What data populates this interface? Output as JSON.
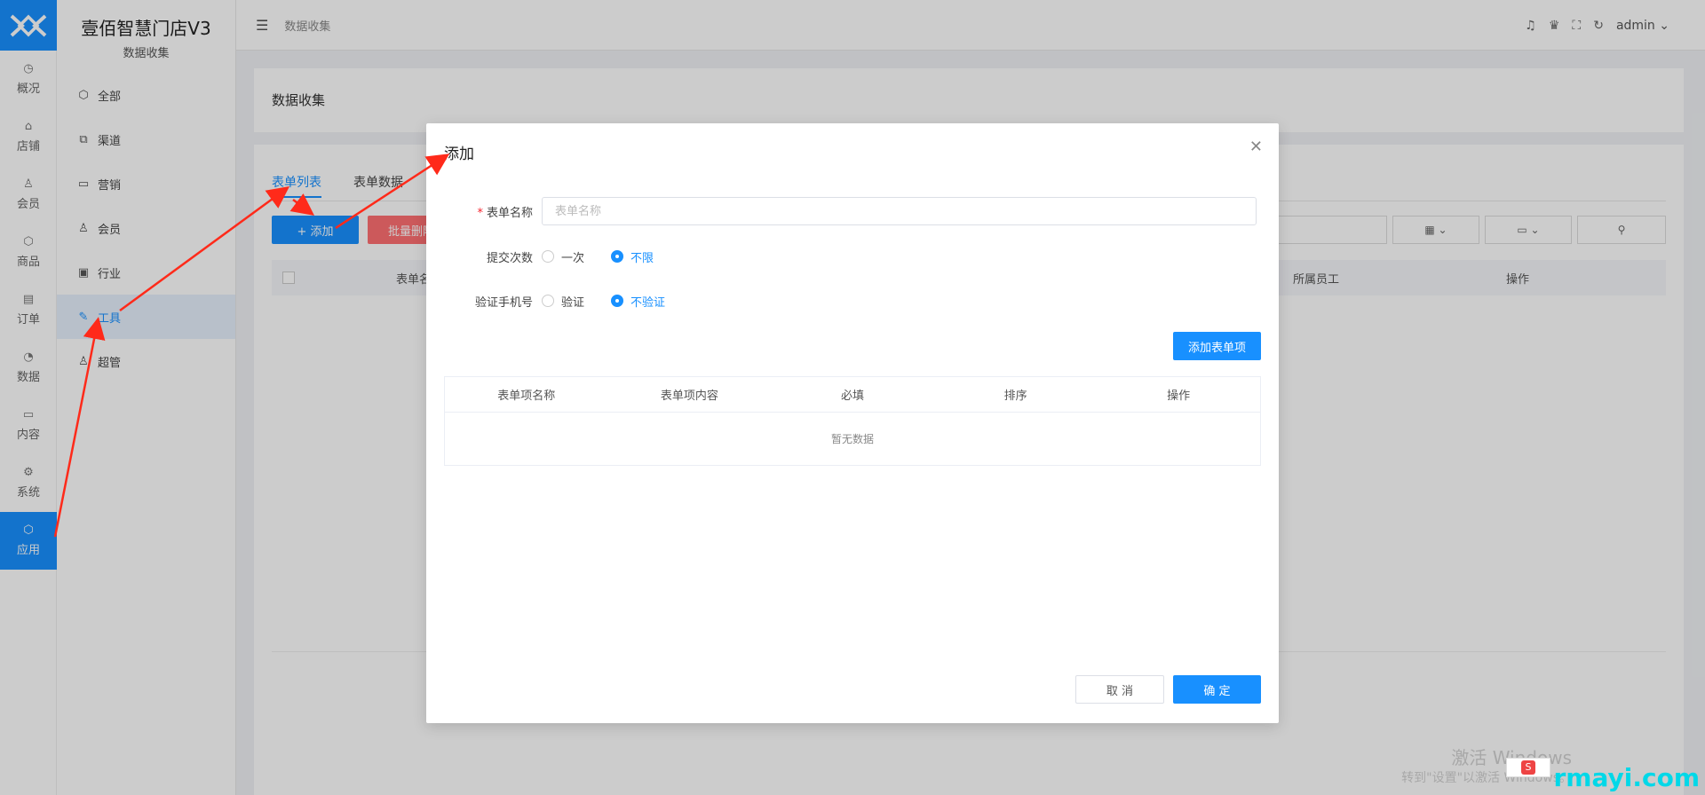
{
  "rail": {
    "items": [
      {
        "label": "概况",
        "icon": "dashboard-icon"
      },
      {
        "label": "店铺",
        "icon": "store-icon"
      },
      {
        "label": "会员",
        "icon": "user-icon"
      },
      {
        "label": "商品",
        "icon": "box-icon"
      },
      {
        "label": "订单",
        "icon": "clipboard-icon"
      },
      {
        "label": "数据",
        "icon": "pie-chart-icon"
      },
      {
        "label": "内容",
        "icon": "file-icon"
      },
      {
        "label": "系统",
        "icon": "gear-icon"
      },
      {
        "label": "应用",
        "icon": "app-icon"
      }
    ]
  },
  "sidebar": {
    "title": "壹佰智慧门店V3",
    "subtitle": "数据收集",
    "items": [
      {
        "label": "全部"
      },
      {
        "label": "渠道"
      },
      {
        "label": "营销"
      },
      {
        "label": "会员"
      },
      {
        "label": "行业"
      },
      {
        "label": "工具"
      },
      {
        "label": "超管"
      }
    ]
  },
  "header": {
    "breadcrumb": "数据收集",
    "user": "admin"
  },
  "page": {
    "title": "数据收集",
    "tabs": [
      "表单列表",
      "表单数据"
    ],
    "add_button": "+ 添加",
    "batch_button": "批量删除",
    "columns": [
      "表单名称",
      "所属员工",
      "操作"
    ]
  },
  "modal": {
    "title": "添加",
    "form_name_label": "表单名称",
    "form_name_placeholder": "表单名称",
    "submit_times_label": "提交次数",
    "submit_options": [
      "一次",
      "不限"
    ],
    "verify_phone_label": "验证手机号",
    "verify_options": [
      "验证",
      "不验证"
    ],
    "add_item_button": "添加表单项",
    "table_columns": [
      "表单项名称",
      "表单项内容",
      "必填",
      "排序",
      "操作"
    ],
    "empty_text": "暂无数据",
    "cancel": "取 消",
    "confirm": "确 定"
  },
  "watermark": {
    "line1": "激活 Windows",
    "line2": "转到\"设置\"以激活 Windows。",
    "site": "rmayi.com"
  },
  "colors": {
    "primary": "#1890ff",
    "danger": "#ff4d4f",
    "arrow": "#ff2a1a"
  }
}
